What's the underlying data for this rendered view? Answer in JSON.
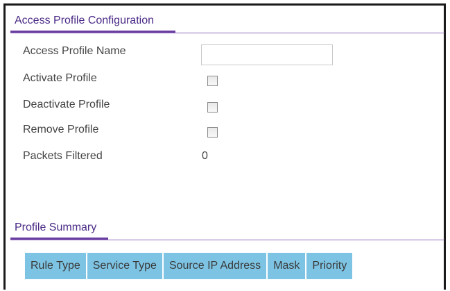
{
  "access_profile": {
    "title": "Access Profile Configuration",
    "name_label": "Access Profile Name",
    "name_value": "",
    "activate_label": "Activate Profile",
    "activate_checked": false,
    "deactivate_label": "Deactivate Profile",
    "deactivate_checked": false,
    "remove_label": "Remove Profile",
    "remove_checked": false,
    "packets_label": "Packets Filtered",
    "packets_value": "0"
  },
  "profile_summary": {
    "title": "Profile Summary",
    "columns": [
      "Rule Type",
      "Service Type",
      "Source IP Address",
      "Mask",
      "Priority"
    ]
  },
  "colors": {
    "accent": "#6b3fa0",
    "table_header": "#7dc4e4"
  }
}
